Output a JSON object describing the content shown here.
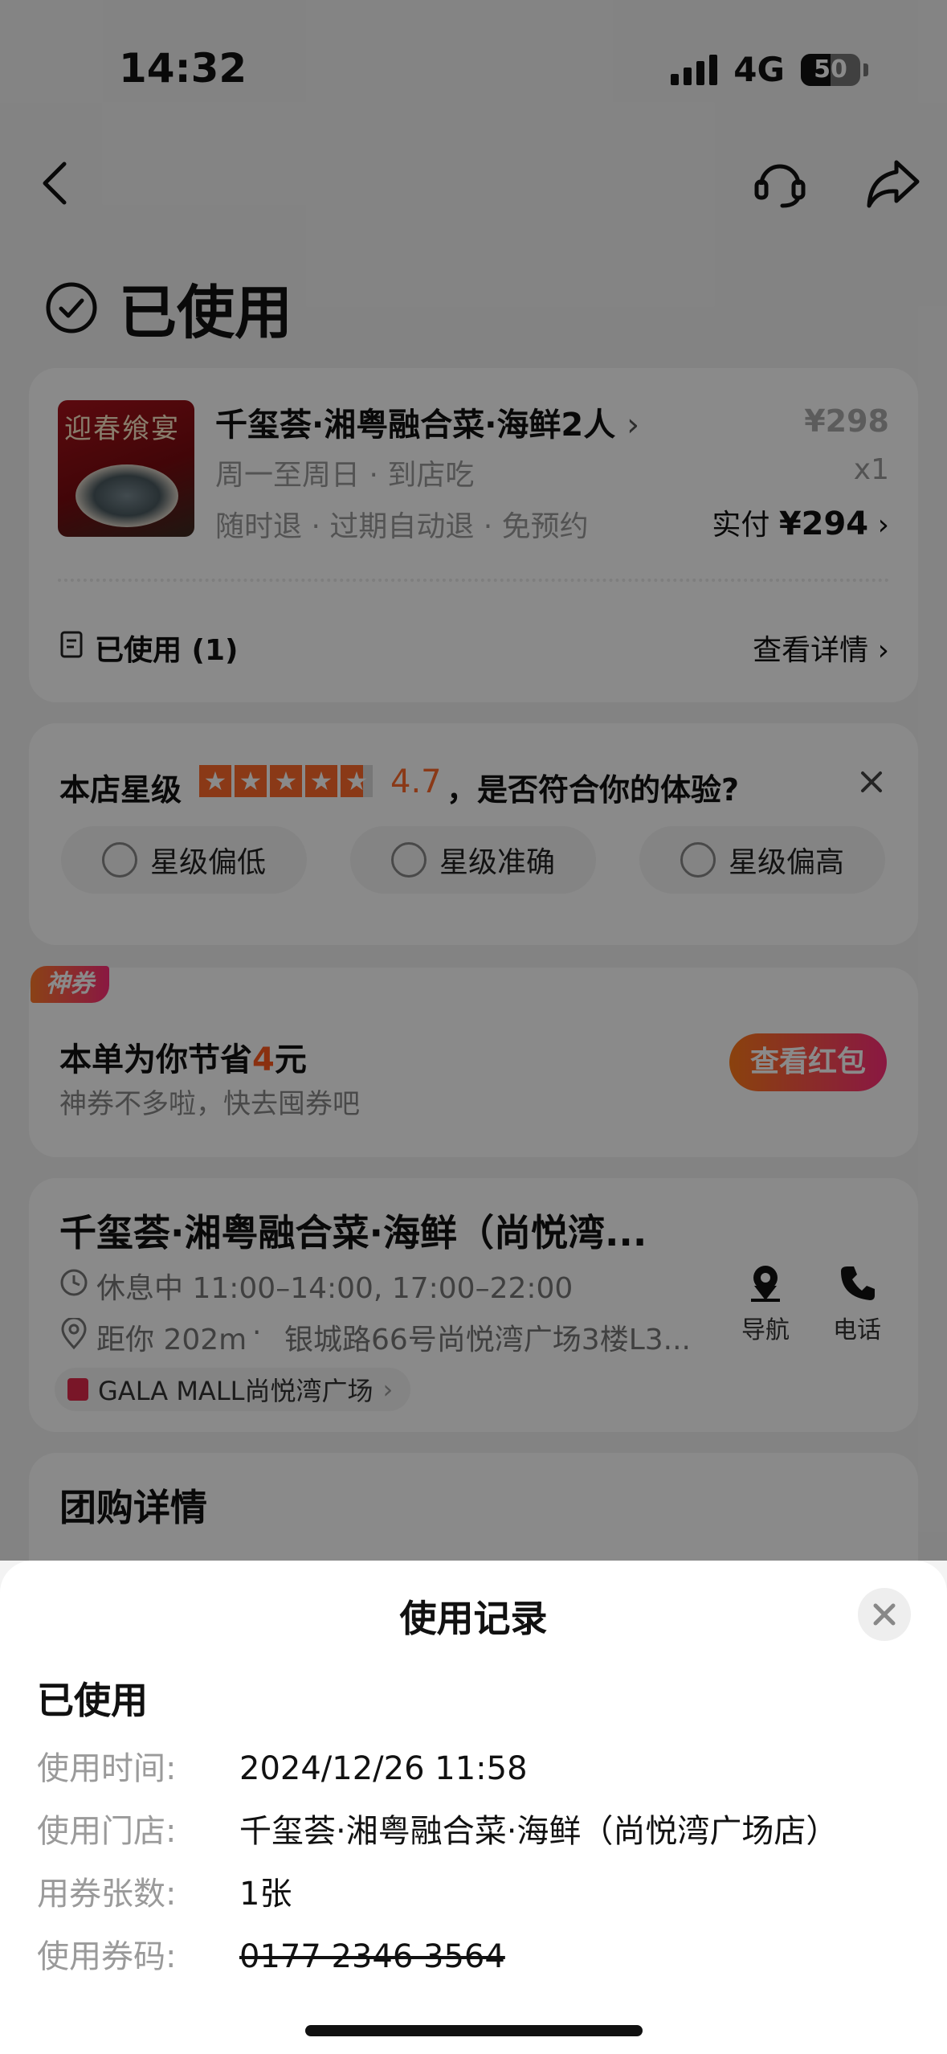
{
  "status_bar": {
    "time": "14:32",
    "network": "4G",
    "battery": "50"
  },
  "header": {
    "status_title": "已使用"
  },
  "order": {
    "image_text": "迎春飨宴",
    "product_name": "千玺荟·湘粤融合菜·海鲜2人",
    "original_price": "¥298",
    "days": "周一至周日 · 到店吃",
    "quantity": "x1",
    "policies": "随时退 · 过期自动退 · 免预约",
    "paid_label": "实付",
    "paid_amount": "¥294",
    "used_label": "已使用 (1)",
    "detail_link": "查看详情"
  },
  "rating": {
    "label": "本店星级",
    "score": "4.7",
    "stars": 4.7,
    "question": "，是否符合你的体验?",
    "options": [
      "星级偏低",
      "星级准确",
      "星级偏高"
    ]
  },
  "coupon": {
    "tag": "神券",
    "saving_prefix": "本单为你节省",
    "saving_amount": "4",
    "saving_suffix": "元",
    "subtitle": "神券不多啦，快去囤券吧",
    "button": "查看红包"
  },
  "store": {
    "name": "千玺荟·湘粤融合菜·海鲜（尚悦湾...",
    "hours": "休息中 11:00–14:00, 17:00–22:00",
    "distance": "距你 202m",
    "address": "银城路66号尚悦湾广场3楼L3...",
    "mall": "GALA MALL尚悦湾广场",
    "nav_label": "导航",
    "phone_label": "电话"
  },
  "deal": {
    "title": "团购详情"
  },
  "sheet": {
    "title": "使用记录",
    "status": "已使用",
    "rows": [
      {
        "label": "使用时间:",
        "value": "2024/12/26 11:58"
      },
      {
        "label": "使用门店:",
        "value": "千玺荟·湘粤融合菜·海鲜（尚悦湾广场店）"
      },
      {
        "label": "用券张数:",
        "value": "1张"
      },
      {
        "label": "使用券码:",
        "value": "0177 2346 3564"
      }
    ]
  },
  "colors": {
    "accent": "#ff5a1f",
    "star": "#ff6a2b",
    "pink": "#ff2d7a",
    "mask": "#000000"
  }
}
